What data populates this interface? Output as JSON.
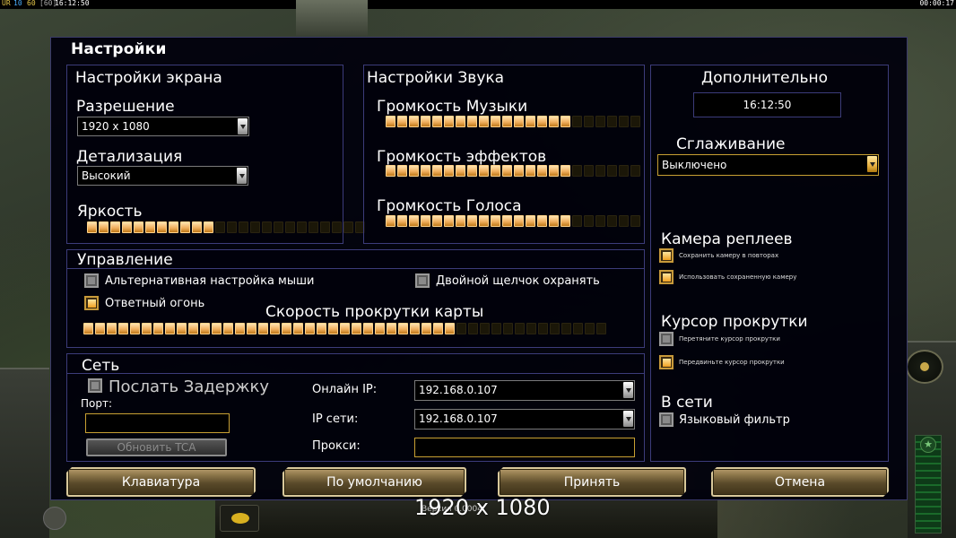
{
  "status_bar": {
    "left_tag": "UR",
    "left_num1": "10",
    "left_num2": "60",
    "left_num3": "[60]",
    "clock": "16:12:50",
    "timer": "00:00:17"
  },
  "dialog": {
    "title": "Настройки",
    "screen": {
      "title": "Настройки экрана",
      "resolution_label": "Разрешение",
      "resolution_value": "1920 x 1080",
      "detail_label": "Детализация",
      "detail_value": "Высокий",
      "brightness_label": "Яркость",
      "brightness_level": 11,
      "brightness_total": 24
    },
    "sound": {
      "title": "Настройки Звука",
      "music_label": "Громкость Музыки",
      "music_level": 16,
      "effects_label": "Громкость эффектов",
      "effects_level": 16,
      "voice_label": "Громкость Голоса",
      "voice_level": 16,
      "slider_total": 22
    },
    "extra": {
      "title": "Дополнительно",
      "clock": "16:12:50",
      "antialias_label": "Сглаживание",
      "antialias_value": "Выключено",
      "replay_camera_label": "Камера реплеев",
      "replay_opt1": "Сохранить камеру в повторах",
      "replay_opt2": "Использовать сохраненную камеру",
      "scroll_cursor_label": "Курсор прокрутки",
      "scroll_opt1": "Перетяните курсор прокрутки",
      "scroll_opt2": "Передвиньте курсор прокрутки",
      "online_label": "В сети",
      "lang_filter": "Языковый фильтр"
    },
    "controls": {
      "title": "Управление",
      "alt_mouse": "Альтернативная настройка мыши",
      "double_click": "Двойной щелчок охранять",
      "return_fire": "Ответный огонь",
      "scroll_speed_label": "Скорость прокрутки карты",
      "scroll_speed_level": 32,
      "scroll_speed_total": 45
    },
    "network": {
      "title": "Сеть",
      "send_delay": "Послать Задержку",
      "port_label": "Порт:",
      "update_tca": "Обновить TCA",
      "online_ip_label": "Онлайн IP:",
      "online_ip_value": "192.168.0.107",
      "lan_ip_label": "IP сети:",
      "lan_ip_value": "192.168.0.107",
      "proxy_label": "Прокси:"
    },
    "buttons": {
      "keyboard": "Клавиатура",
      "defaults": "По умолчанию",
      "accept": "Принять",
      "cancel": "Отмена"
    }
  },
  "footer": {
    "resolution_caption": "1920 x 1080",
    "version": "Версия 0.0004"
  },
  "colors": {
    "accent_gold": "#c8a032",
    "slider_on": "#f0b060",
    "panel_border": "#3c3c7a"
  }
}
